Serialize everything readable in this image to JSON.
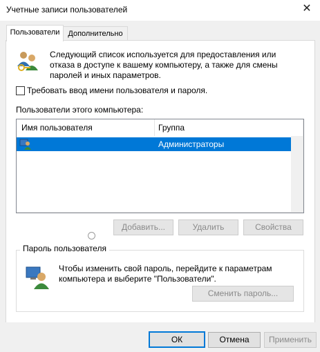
{
  "window": {
    "title": "Учетные записи пользователей",
    "close_glyph": "✕"
  },
  "tabs": [
    {
      "label": "Пользователи",
      "active": true
    },
    {
      "label": "Дополнительно",
      "active": false
    }
  ],
  "intro": {
    "text": "Следующий список используется для предоставления или отказа в доступе к вашему компьютеру, а также для смены паролей и иных параметров.",
    "icon": "users-keys-icon"
  },
  "require_login": {
    "label": "Требовать ввод имени пользователя и пароля.",
    "checked": false
  },
  "users": {
    "label": "Пользователи этого компьютера:",
    "columns": [
      "Имя пользователя",
      "Группа"
    ],
    "rows": [
      {
        "name": "",
        "group": "Администраторы",
        "selected": true
      }
    ]
  },
  "list_buttons": {
    "add": "Добавить...",
    "remove": "Удалить",
    "properties": "Свойства"
  },
  "password_group": {
    "title": "Пароль пользователя",
    "text": "Чтобы изменить свой пароль, перейдите к параметрам компьютера и выберите \"Пользователи\".",
    "change_button": "Сменить пароль...",
    "icon": "user-computer-icon"
  },
  "dialog_buttons": {
    "ok": "ОК",
    "cancel": "Отмена",
    "apply": "Применить"
  },
  "colors": {
    "selection": "#0078d7",
    "panel": "#ffffff",
    "chrome": "#f0f0f0"
  }
}
